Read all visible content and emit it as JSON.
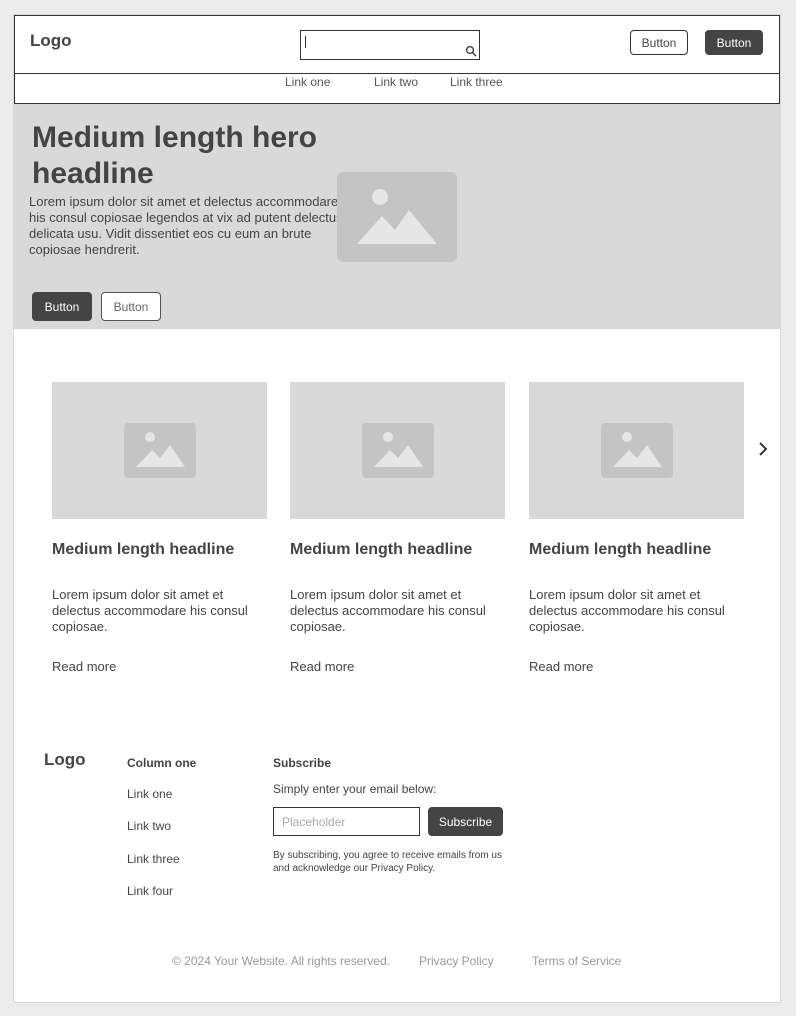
{
  "header": {
    "logo": "Logo",
    "search": {
      "value": "",
      "placeholder": ""
    },
    "button_outline": "Button",
    "button_dark": "Button"
  },
  "nav": {
    "links": [
      "Link one",
      "Link two",
      "Link three"
    ]
  },
  "hero": {
    "headline": "Medium length hero headline",
    "body": "Lorem ipsum dolor sit amet et delectus accommodare his consul copiosae legendos at vix ad putent delectus delicata usu. Vidit dissentiet eos cu eum an brute copiosae hendrerit.",
    "primary_button": "Button",
    "secondary_button": "Button"
  },
  "cards": [
    {
      "headline": "Medium length headline",
      "body": "Lorem ipsum dolor sit amet et delectus accommodare his consul copiosae.",
      "link": "Read more"
    },
    {
      "headline": "Medium length headline",
      "body": "Lorem ipsum dolor sit amet et delectus accommodare his consul copiosae.",
      "link": "Read more"
    },
    {
      "headline": "Medium length headline",
      "body": "Lorem ipsum dolor sit amet et delectus accommodare his consul copiosae.",
      "link": "Read more"
    }
  ],
  "footer": {
    "logo": "Logo",
    "column_heading": "Column one",
    "links": [
      "Link one",
      "Link two",
      "Link three",
      "Link four"
    ],
    "subscribe_heading": "Subscribe",
    "subscribe_text": "Simply enter your email below:",
    "email_placeholder": "Placeholder",
    "subscribe_button": "Subscribe",
    "legal": "By subscribing, you agree to receive emails from us and acknowledge our Privacy Policy."
  },
  "bottom": {
    "copyright": "© 2024 Your Website. All rights reserved.",
    "privacy": "Privacy Policy",
    "terms": "Terms of Service"
  },
  "colors": {
    "background": "#ececec",
    "placeholder_fill": "#d9d9d9",
    "dark_button": "#444444",
    "text": "#444444"
  }
}
